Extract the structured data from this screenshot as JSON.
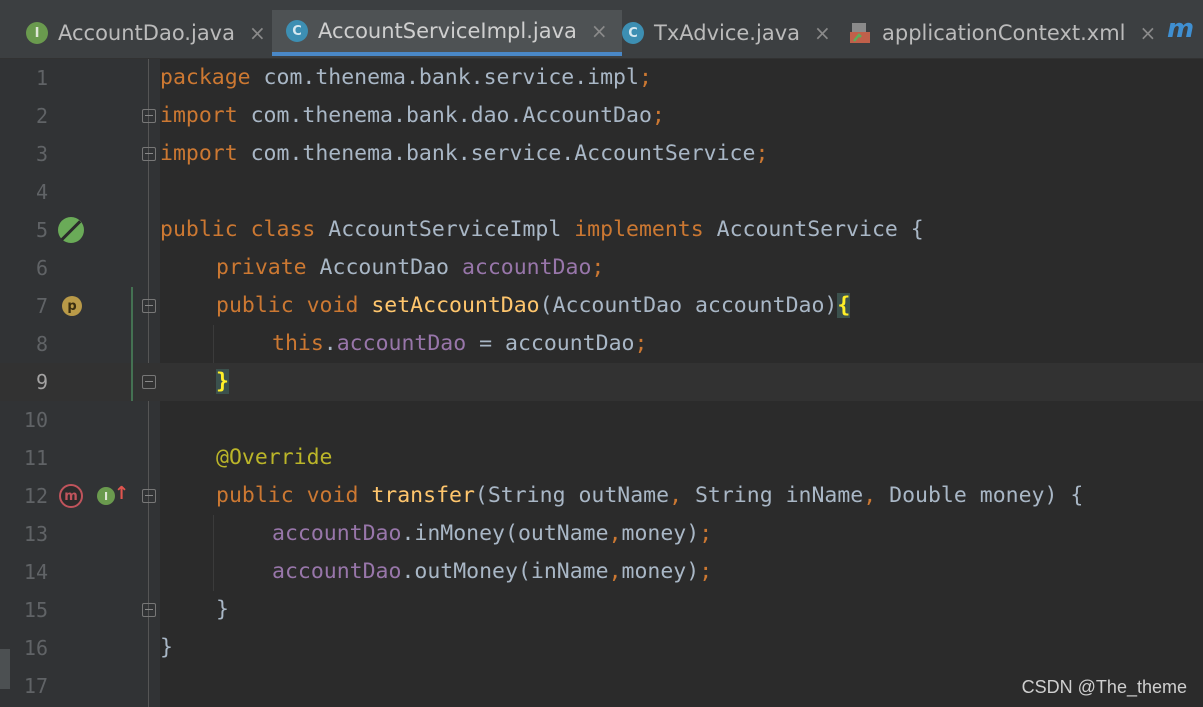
{
  "tabs": [
    {
      "label": "AccountDao.java",
      "icon": "interface-icon",
      "icon_glyph": "I",
      "active": false
    },
    {
      "label": "AccountServiceImpl.java",
      "icon": "class-icon",
      "icon_glyph": "C",
      "active": true
    },
    {
      "label": "TxAdvice.java",
      "icon": "class-icon",
      "icon_glyph": "C",
      "active": false
    },
    {
      "label": "applicationContext.xml",
      "icon": "xml-icon",
      "icon_glyph": "",
      "active": false
    }
  ],
  "tab_close_glyph": "×",
  "tab_more_glyph": "m",
  "line_numbers": [
    "1",
    "2",
    "3",
    "4",
    "5",
    "6",
    "7",
    "8",
    "9",
    "10",
    "11",
    "12",
    "13",
    "14",
    "15",
    "16",
    "17"
  ],
  "current_line": "9",
  "code": {
    "l1": [
      "package",
      " com.thenema.bank.service.impl",
      ";"
    ],
    "l2": [
      "import",
      " com.thenema.bank.dao.AccountDao",
      ";"
    ],
    "l3": [
      "import",
      " com.thenema.bank.service.AccountService",
      ";"
    ],
    "l5": [
      "public class",
      " AccountServiceImpl ",
      "implements",
      " AccountService {"
    ],
    "l6": [
      "private",
      " AccountDao ",
      "accountDao",
      ";"
    ],
    "l7": [
      "public void",
      " ",
      "setAccountDao",
      "(AccountDao accountDao)",
      "{"
    ],
    "l8": [
      "this",
      ".",
      "accountDao",
      " = accountDao",
      ";"
    ],
    "l9": [
      "}"
    ],
    "l11": [
      "@Override"
    ],
    "l12": [
      "public void",
      " ",
      "transfer",
      "(String outName",
      ",",
      " String inName",
      ",",
      " Double money) {"
    ],
    "l13": [
      "accountDao",
      ".inMoney(outName",
      ",",
      "money)",
      ";"
    ],
    "l14": [
      "accountDao",
      ".outMoney(inName",
      ",",
      "money)",
      ";"
    ],
    "l15": [
      "}"
    ],
    "l16": [
      "}"
    ]
  },
  "gutter_icons": {
    "bean": "spring-bean-icon",
    "property": "spring-property-icon",
    "property_glyph": "p",
    "method_override": "implements-method-icon",
    "method_glyph": "m",
    "implements": "interface-implemented-icon",
    "implements_glyph": "I",
    "up_arrow_glyph": "↑"
  },
  "colors": {
    "background": "#2b2b2b",
    "keyword": "#cc7832",
    "field": "#9876aa",
    "method": "#ffc66d",
    "annotation": "#bbb529",
    "plain": "#a9b7c6",
    "active_tab_underline": "#4a88c7"
  },
  "watermark": "CSDN @The_theme"
}
